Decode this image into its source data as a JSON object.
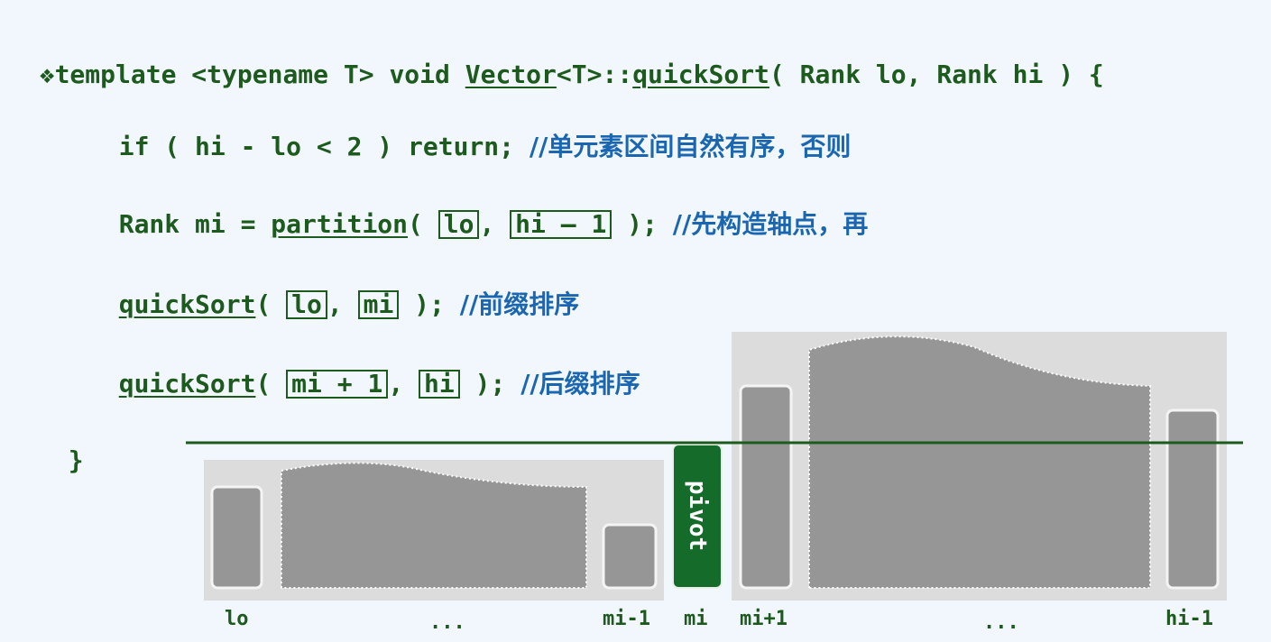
{
  "code": {
    "bullet": "❖",
    "line1": {
      "pre": "template <typename T> void ",
      "vector": "Vector",
      "mid": "<T>::",
      "fn": "quickSort",
      "post": "( Rank lo, Rank hi ) {"
    },
    "line2": {
      "code": "if ( hi - lo < 2 ) return; ",
      "comment": "//单元素区间自然有序，否则"
    },
    "line3": {
      "pre": "Rank mi = ",
      "fn": "partition",
      "open": "( ",
      "arg1": "lo",
      "sep": ", ",
      "arg2": "hi – 1",
      "close": " ); ",
      "comment": "//先构造轴点，再"
    },
    "line4": {
      "fn": "quickSort",
      "open": "( ",
      "arg1": "lo",
      "sep": ", ",
      "arg2": "mi",
      "close": " ); ",
      "comment": "//前缀排序"
    },
    "line5": {
      "fn": "quickSort",
      "open": "( ",
      "arg1": "mi + 1",
      "sep": ", ",
      "arg2": "hi",
      "close": " ); ",
      "comment": "//后缀排序"
    },
    "line6": "}"
  },
  "diagram": {
    "pivot_label": "pivot",
    "labels": {
      "lo": "lo",
      "dots_left": "...",
      "mi_minus_1": "mi-1",
      "mi": "mi",
      "mi_plus_1": "mi+1",
      "dots_right": "...",
      "hi_minus_1": "hi-1"
    },
    "colors": {
      "panel": "#dcdcdc",
      "bar": "#969696",
      "pivot": "#146b2a",
      "line": "#1d5a1d"
    }
  }
}
